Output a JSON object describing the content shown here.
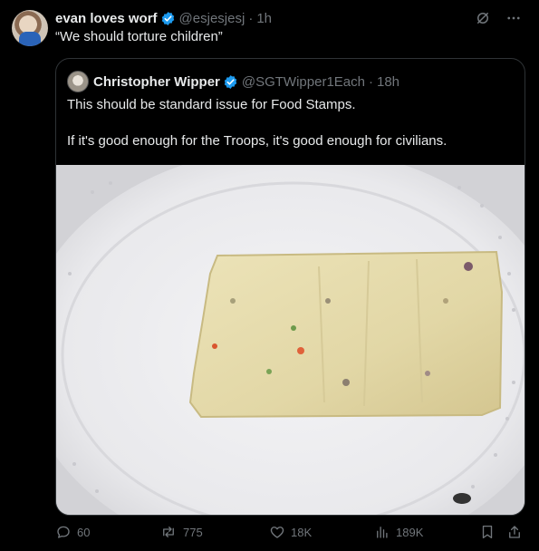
{
  "post": {
    "author_name": "evan loves worf",
    "author_handle": "@esjesjesj",
    "time": "1h",
    "text": "“We should torture children”"
  },
  "quote": {
    "author_name": "Christopher Wipper",
    "author_handle": "@SGTWipper1Each",
    "time": "18h",
    "line1": "This should be standard issue for Food Stamps.",
    "line2": "If it's good enough for the Troops, it's good enough for civilians."
  },
  "actions": {
    "replies": "60",
    "reposts": "775",
    "likes": "18K",
    "views": "189K"
  },
  "separator": "·",
  "colors": {
    "background": "#000000",
    "verified": "#1d9bf0",
    "muted": "#71767b"
  },
  "icons": [
    "grok-icon",
    "more-icon",
    "verified-badge-icon",
    "reply-icon",
    "repost-icon",
    "like-icon",
    "views-icon",
    "bookmark-icon",
    "share-icon"
  ]
}
